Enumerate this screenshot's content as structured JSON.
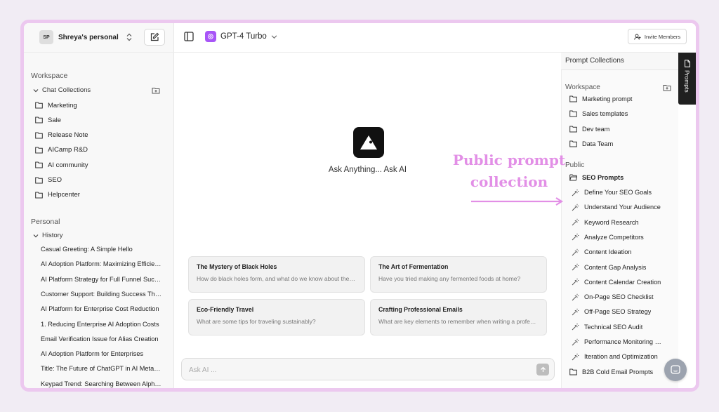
{
  "sidebar": {
    "workspace_badge": "SP",
    "workspace_name": "Shreya's personal",
    "workspace_section": "Workspace",
    "chat_collections_label": "Chat Collections",
    "folders": [
      "Marketing",
      "Sale",
      "Release Note",
      "AICamp R&D",
      "AI community",
      "SEO",
      "Helpcenter"
    ],
    "personal_section": "Personal",
    "history_label": "History",
    "history": [
      "Casual Greeting: A Simple Hello",
      "AI Adoption Platform: Maximizing Efficiency",
      "AI Platform Strategy for Full Funnel Success",
      "Customer Support: Building Success Through AI",
      "AI Platform for Enterprise Cost Reduction",
      "1. Reducing Enterprise AI Adoption Costs",
      "Email Verification Issue for Alias Creation",
      "AI Adoption Platform for Enterprises",
      "Title: The Future of ChatGPT in AI Meta Search",
      "Keypad Trend: Searching Between Alphabets"
    ]
  },
  "topbar": {
    "model_name": "GPT-4 Turbo",
    "invite_label": "Invite Members"
  },
  "main": {
    "hero_text": "Ask Anything... Ask AI",
    "cards": [
      {
        "title": "The Mystery of Black Holes",
        "subtitle": "How do black holes form, and what do we know about them?"
      },
      {
        "title": "The Art of Fermentation",
        "subtitle": "Have you tried making any fermented foods at home?"
      },
      {
        "title": "Eco-Friendly Travel",
        "subtitle": "What are some tips for traveling sustainably?"
      },
      {
        "title": "Crafting Professional Emails",
        "subtitle": "What are key elements to remember when writing a professional email?"
      }
    ],
    "ask_placeholder": "Ask AI ..."
  },
  "annotation": {
    "text_line1": "Public prompt",
    "text_line2": "collection",
    "color": "#e28fe6"
  },
  "prompt_panel": {
    "title": "Prompt Collections",
    "tab_label": "Prompts",
    "workspace_section": "Workspace",
    "workspace_items": [
      "Marketing prompt",
      "Sales templates",
      "Dev team",
      "Data Team"
    ],
    "public_section": "Public",
    "open_folder": "SEO Prompts",
    "prompts": [
      "Define Your SEO Goals",
      "Understand Your Audience",
      "Keyword Research",
      "Analyze Competitors",
      "Content Ideation",
      "Content Gap Analysis",
      "Content Calendar Creation",
      "On-Page SEO Checklist",
      "Off-Page SEO Strategy",
      "Technical SEO Audit",
      "Performance Monitoring and Reporting",
      "Iteration and Optimization"
    ],
    "other_folder": "B2B Cold Email Prompts"
  },
  "colors": {
    "accent": "#a855f7",
    "frame": "#ecc8ef"
  }
}
